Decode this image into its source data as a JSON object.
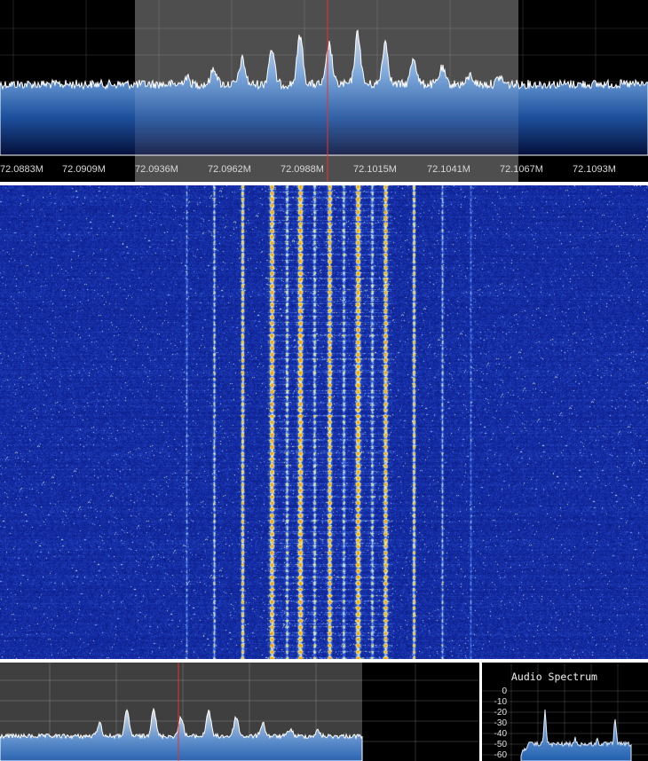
{
  "spectrum": {
    "freq_labels": [
      "72.0883M",
      "72.0909M",
      "72.0936M",
      "72.0962M",
      "72.0988M",
      "72.1015M",
      "72.1041M",
      "72.1067M",
      "72.1093M"
    ]
  },
  "audio": {
    "title": "Audio Spectrum",
    "db_ticks": [
      "0",
      "-10",
      "-20",
      "-30",
      "-40",
      "-50",
      "-60"
    ]
  },
  "colors": {
    "cursor": "#e8322a",
    "trace_fill_top": "#cfd6e4",
    "trace_fill_bottom": "#2f6fb8",
    "waterfall_background": "#0a1b7a",
    "waterfall_signal": "#ffe21a",
    "passband_shade": "#4a4a4a"
  }
}
